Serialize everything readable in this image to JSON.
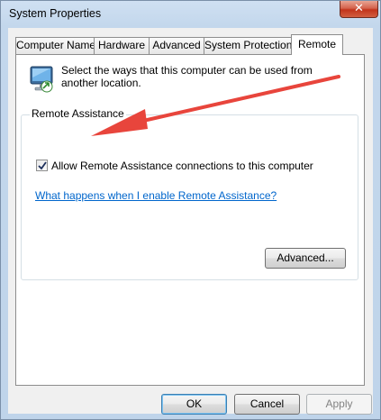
{
  "window": {
    "title": "System Properties",
    "close_glyph": "✕"
  },
  "tabs": [
    {
      "label": "Computer Name",
      "active": false
    },
    {
      "label": "Hardware",
      "active": false
    },
    {
      "label": "Advanced",
      "active": false
    },
    {
      "label": "System Protection",
      "active": false
    },
    {
      "label": "Remote",
      "active": true
    }
  ],
  "remote": {
    "description": "Select the ways that this computer can be used from another location.",
    "icon": "remote-computer-icon",
    "group_title": "Remote Assistance",
    "allow_checkbox": {
      "label": "Allow Remote Assistance connections to this computer",
      "checked": true
    },
    "help_link": "What happens when I enable Remote Assistance?",
    "advanced_button": "Advanced..."
  },
  "footer": {
    "ok": "OK",
    "cancel": "Cancel",
    "apply": "Apply",
    "apply_enabled": false
  },
  "annotation": {
    "arrow_color": "#e8453c"
  }
}
